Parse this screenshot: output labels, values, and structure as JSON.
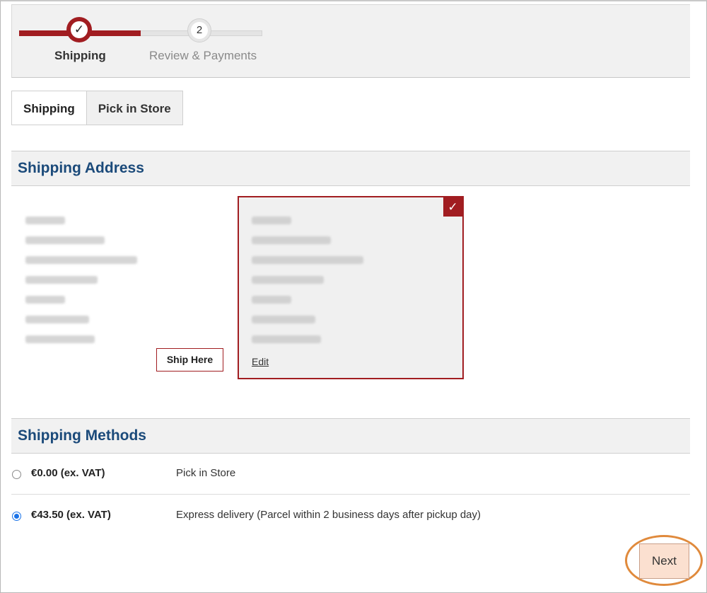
{
  "progress": {
    "steps": [
      {
        "number": "✓",
        "label": "Shipping",
        "state": "complete"
      },
      {
        "number": "2",
        "label": "Review & Payments",
        "state": "pending"
      }
    ]
  },
  "tabs": [
    {
      "label": "Shipping",
      "active": true
    },
    {
      "label": "Pick in Store",
      "active": false
    }
  ],
  "shipping_address": {
    "title": "Shipping Address",
    "ship_here_label": "Ship Here",
    "edit_label": "Edit",
    "selected_badge": "✓"
  },
  "shipping_methods": {
    "title": "Shipping Methods",
    "options": [
      {
        "price": "€0.00 (ex. VAT)",
        "name": "Pick in Store",
        "selected": false
      },
      {
        "price": "€43.50 (ex. VAT)",
        "name": "Express delivery (Parcel within 2 business days after pickup day)",
        "selected": true
      }
    ]
  },
  "next_label": "Next",
  "colors": {
    "accent": "#a11d21",
    "heading": "#1b4a7a",
    "highlight": "#e08a3c"
  }
}
